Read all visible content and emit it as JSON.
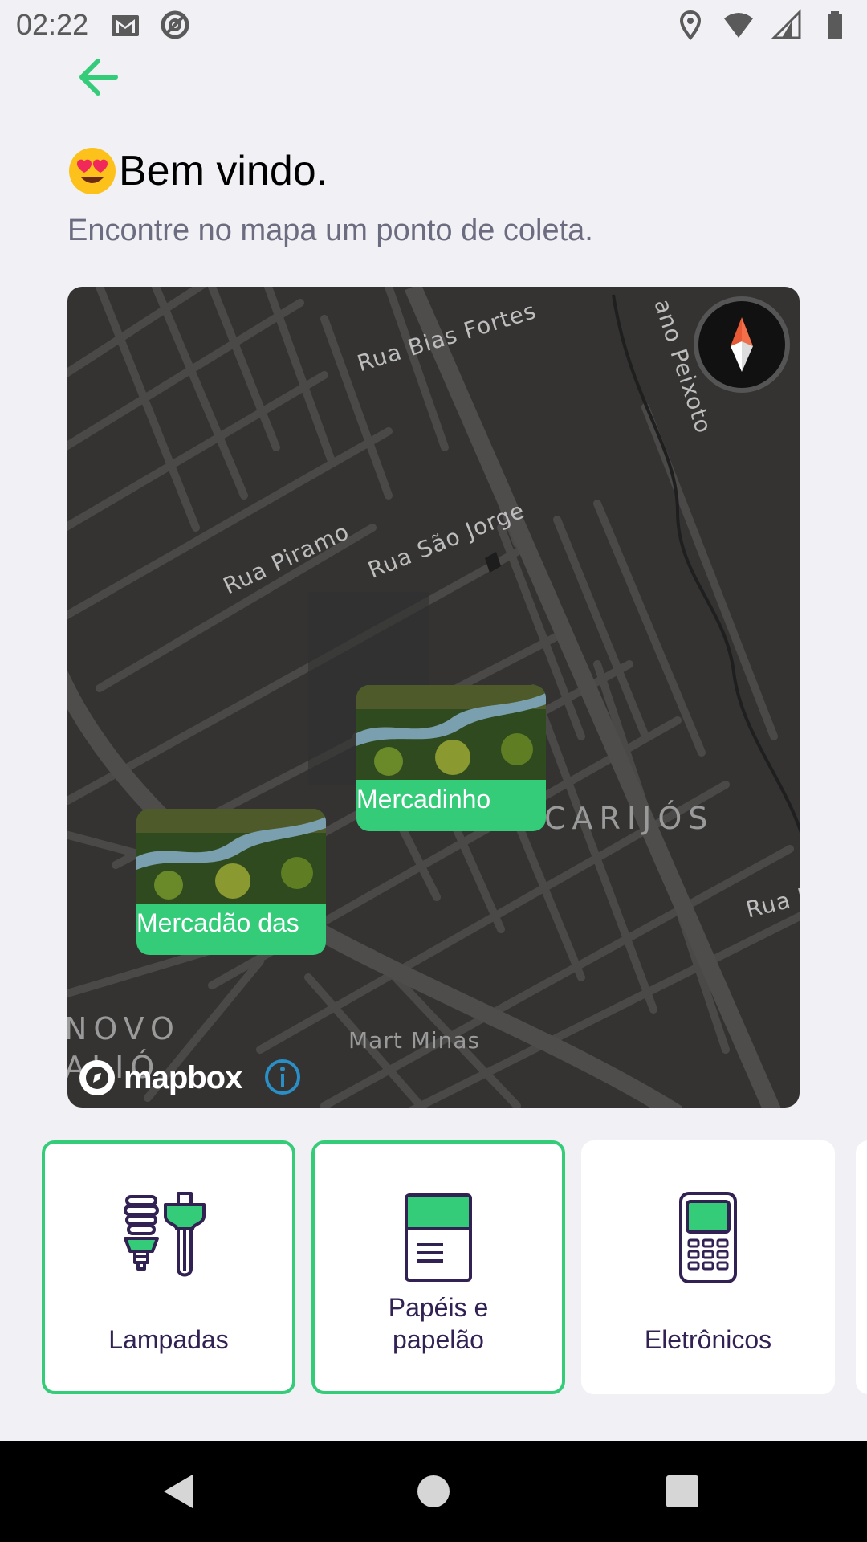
{
  "status_bar": {
    "time": "02:22",
    "left_icons": [
      "gmail-icon",
      "at-sign-icon"
    ],
    "right_icons": [
      "location-icon",
      "wifi-icon",
      "signal-icon",
      "battery-icon"
    ]
  },
  "header": {
    "emoji": "smiling-face-with-heart-eyes",
    "title": "Bem vindo.",
    "subtitle": "Encontre no mapa um ponto de coleta."
  },
  "map": {
    "streets": [
      "Rua Bias Fortes",
      "Rua São Jorge",
      "Rua Piramo",
      "ano Peixoto",
      "Rua J",
      "Mart Minas"
    ],
    "districts": [
      "CARIJÓS",
      "NOVO",
      "ALIÓ"
    ],
    "markers": [
      {
        "label": "Mercadinho"
      },
      {
        "label": "Mercadão das"
      }
    ],
    "attribution": "mapbox"
  },
  "items": [
    {
      "label": "Lampadas",
      "icon": "light-bulbs-icon",
      "selected": true
    },
    {
      "label": "Papéis e papelão",
      "icon": "paper-icon",
      "selected": true
    },
    {
      "label": "Eletrônicos",
      "icon": "electronics-icon",
      "selected": false
    }
  ],
  "colors": {
    "accent": "#34cb79",
    "text_dark": "#322153",
    "text_muted": "#6c6c80",
    "background": "#f0f0f5",
    "map_bg": "#343332"
  }
}
